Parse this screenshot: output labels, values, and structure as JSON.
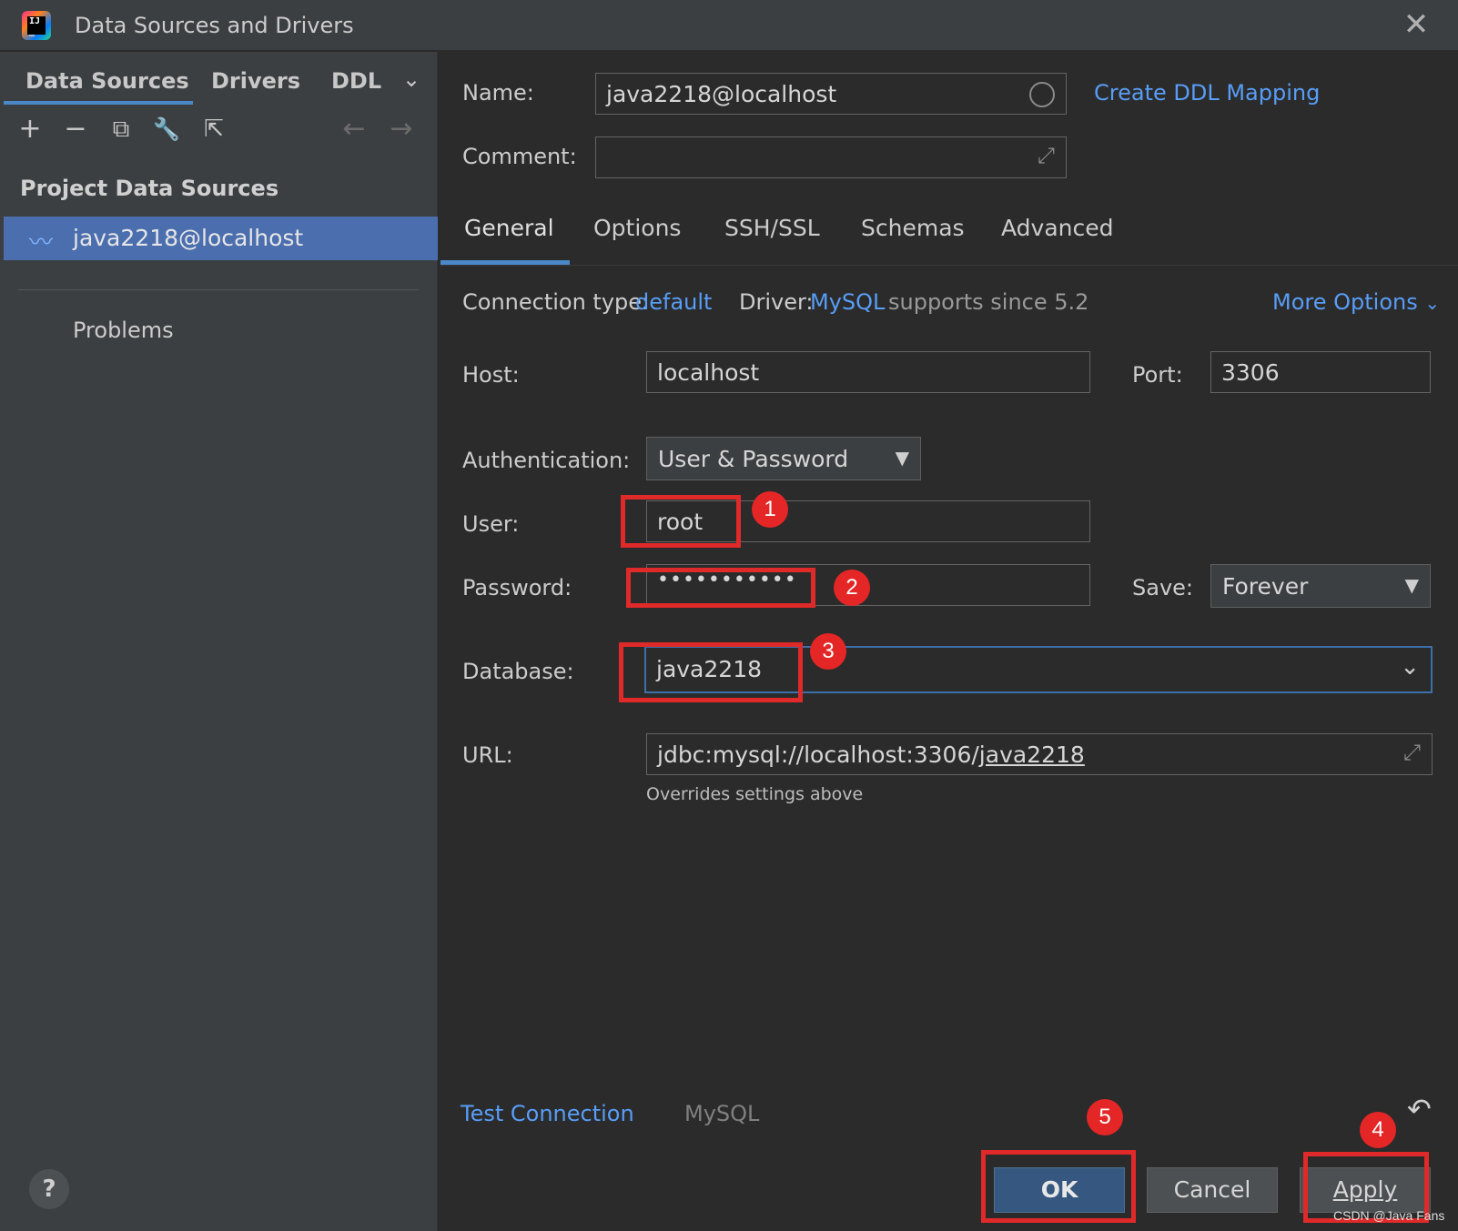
{
  "window": {
    "title": "Data Sources and Drivers",
    "close": "✕"
  },
  "sidebar": {
    "tabs": [
      "Data Sources",
      "Drivers",
      "DDL"
    ],
    "toolbar": {
      "add": "+",
      "remove": "−",
      "copy": "⧉",
      "settings": "🔧",
      "export": "⇱",
      "back": "←",
      "forward": "→"
    },
    "section": "Project Data Sources",
    "items": [
      {
        "label": "java2218@localhost",
        "icon": "mysql-icon"
      }
    ],
    "problems": "Problems",
    "help": "?"
  },
  "form": {
    "name_label": "Name:",
    "name_value": "java2218@localhost",
    "create_ddl": "Create DDL Mapping",
    "comment_label": "Comment:",
    "comment_value": "",
    "tabs": [
      "General",
      "Options",
      "SSH/SSL",
      "Schemas",
      "Advanced"
    ],
    "active_tab": "General",
    "connection_type_label": "Connection type:",
    "connection_type": "default",
    "driver_label": "Driver:",
    "driver": "MySQL",
    "driver_note": "supports since 5.2",
    "more_options": "More Options",
    "host_label": "Host:",
    "host": "localhost",
    "port_label": "Port:",
    "port": "3306",
    "auth_label": "Authentication:",
    "auth": "User & Password",
    "user_label": "User:",
    "user": "root",
    "password_label": "Password:",
    "password_mask": "•••••••••••",
    "save_label": "Save:",
    "save": "Forever",
    "database_label": "Database:",
    "database": "java2218",
    "url_label": "URL:",
    "url_prefix": "jdbc:mysql://localhost:3306/",
    "url_db": "java2218",
    "url_hint": "Overrides settings above"
  },
  "footer": {
    "test_connection": "Test Connection",
    "driver_name": "MySQL",
    "revert": "↶",
    "ok": "OK",
    "cancel": "Cancel",
    "apply": "Apply"
  },
  "annotations": [
    "1",
    "2",
    "3",
    "4",
    "5"
  ],
  "watermark": "CSDN @Java Fans",
  "colors": {
    "accent": "#4a88c7",
    "link": "#589df6",
    "selection": "#4b6eaf",
    "annotation": "#e02a2a"
  }
}
